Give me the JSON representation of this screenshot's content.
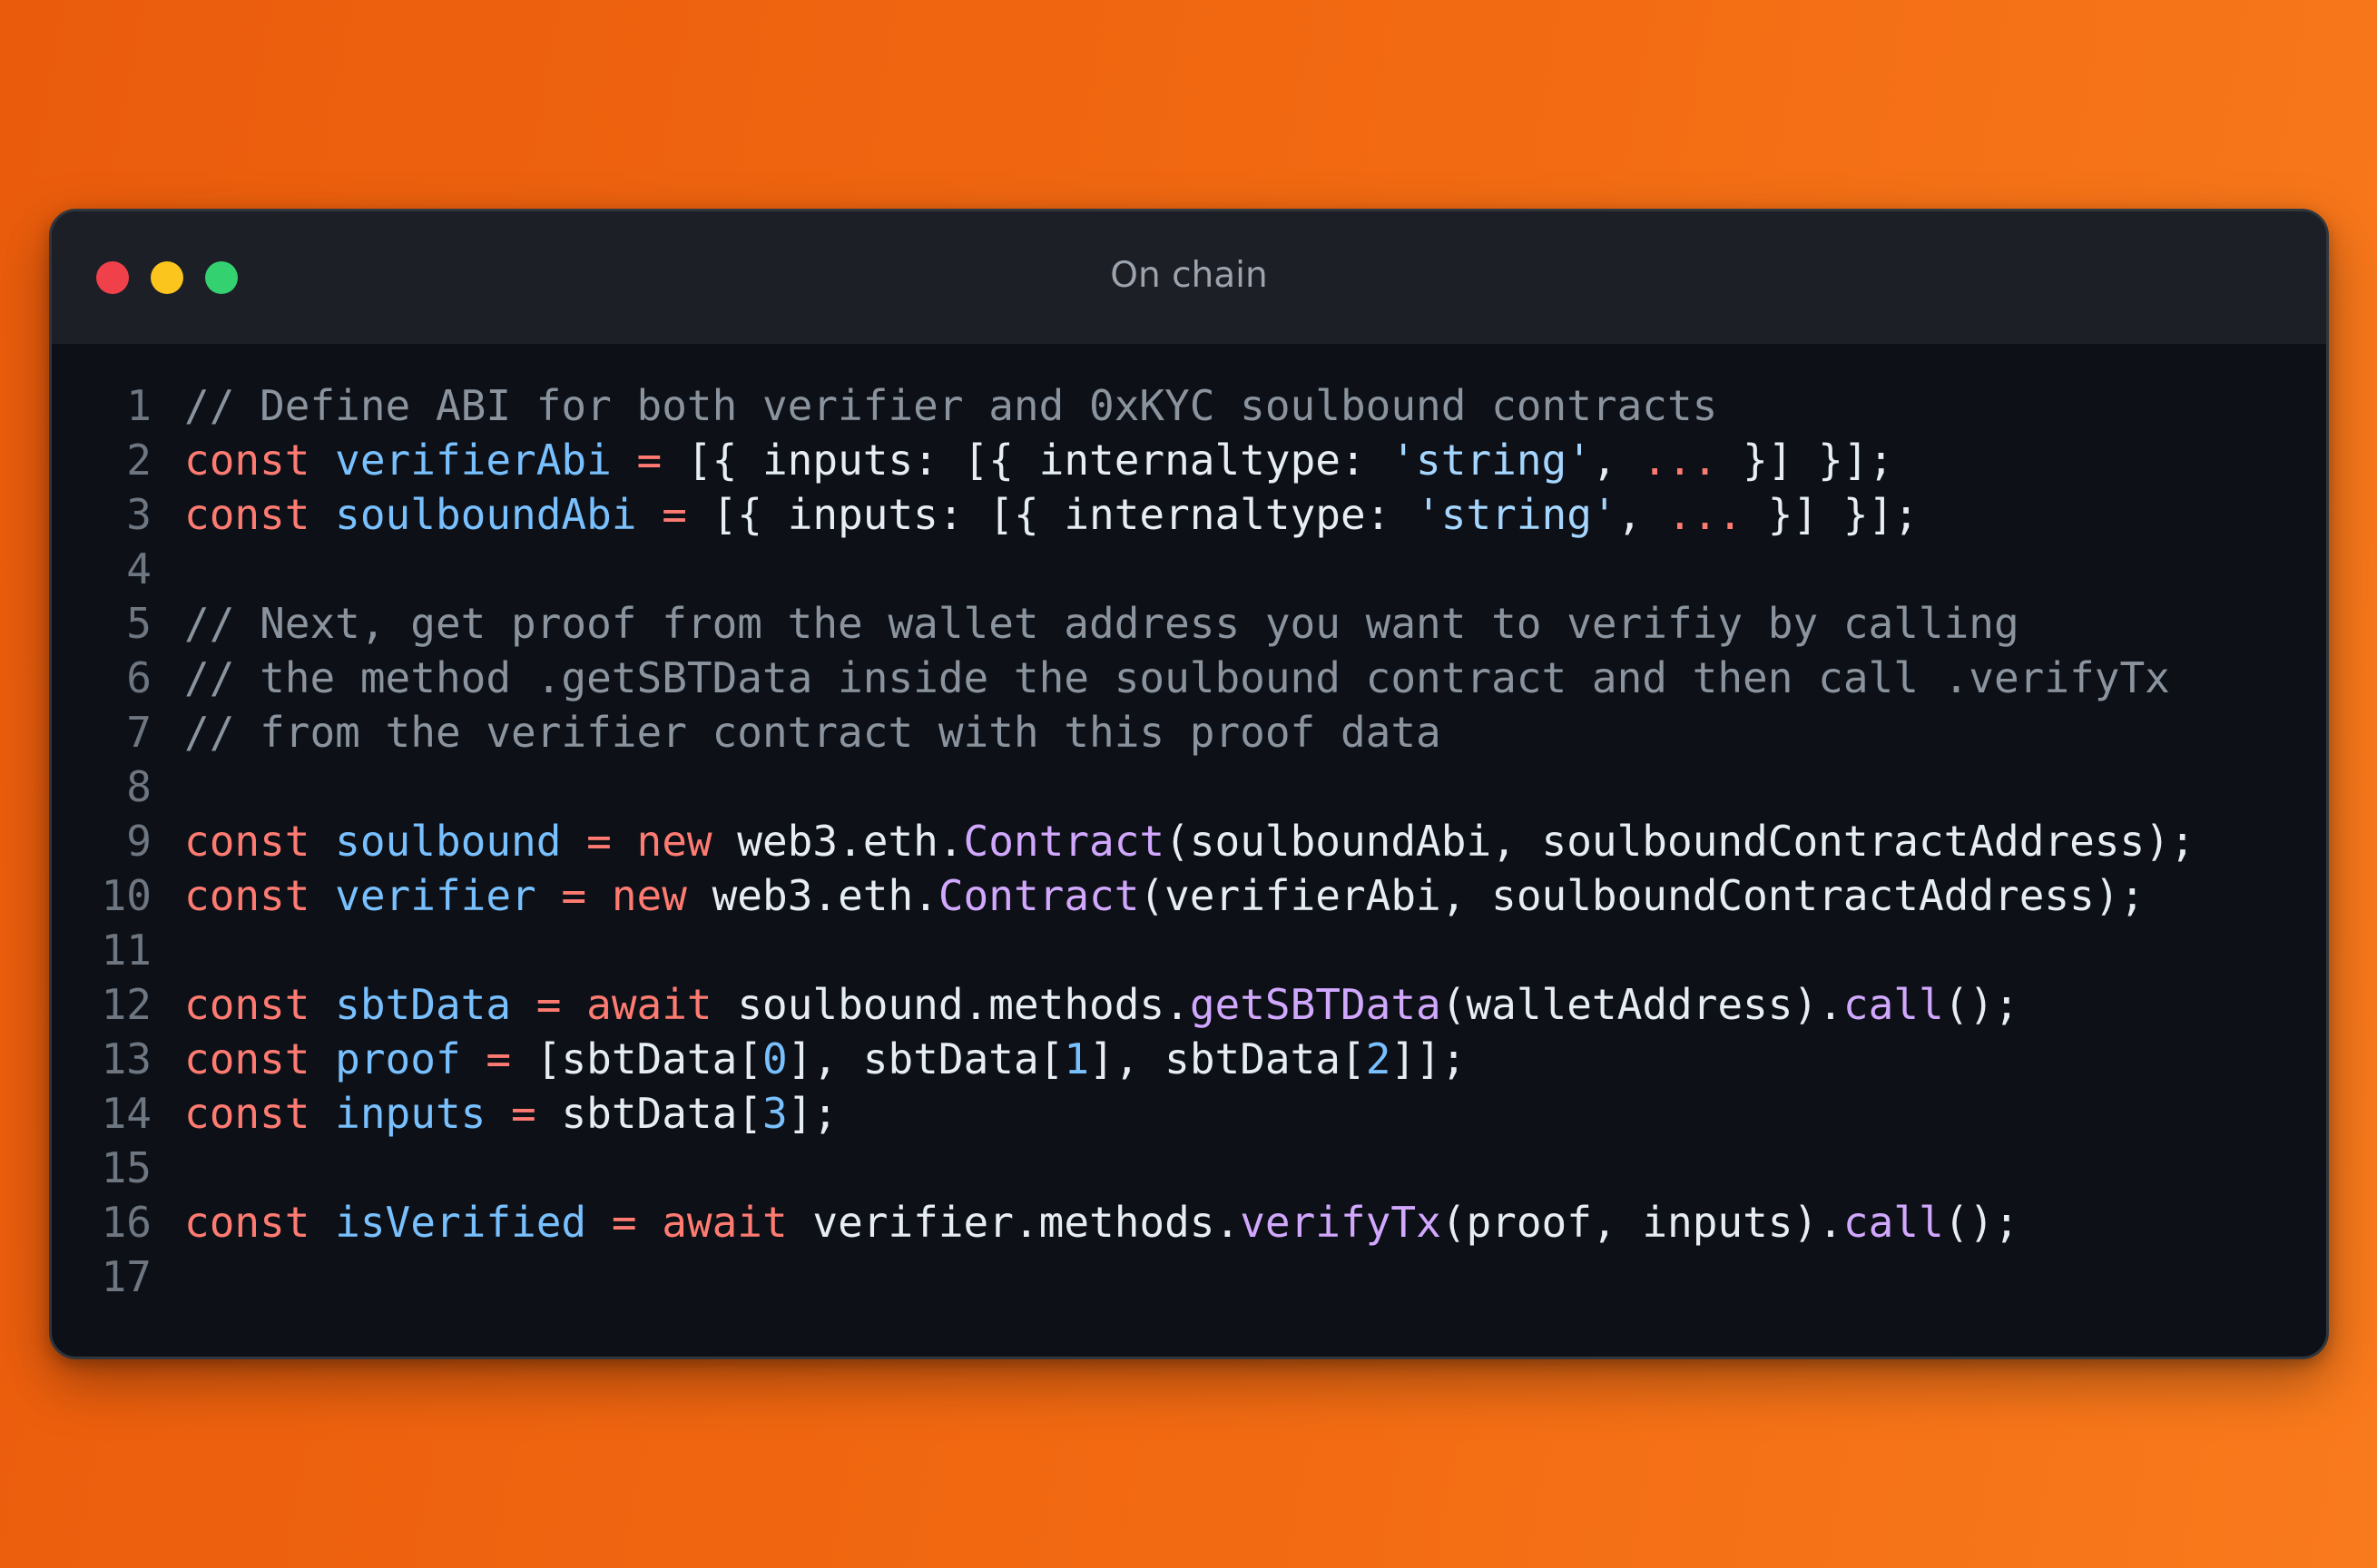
{
  "window": {
    "title": "On chain"
  },
  "colors": {
    "background": "#f26a12",
    "editor_bg": "#0d1117",
    "titlebar_bg": "#1c1f26",
    "comment": "#8b949e",
    "keyword": "#ff7b72",
    "variable": "#79c0ff",
    "string": "#a5d6ff",
    "function": "#d2a8ff",
    "number": "#79c0ff",
    "plain": "#e6edf3"
  },
  "code": {
    "lines": [
      {
        "n": "1",
        "tokens": [
          {
            "t": "// Define ABI for both verifier and 0xKYC soulbound contracts",
            "k": "comment"
          }
        ]
      },
      {
        "n": "2",
        "tokens": [
          {
            "t": "const ",
            "k": "kw"
          },
          {
            "t": "verifierAbi",
            "k": "var"
          },
          {
            "t": " = ",
            "k": "kw"
          },
          {
            "t": "[{ inputs: [{ internaltype: ",
            "k": "plain"
          },
          {
            "t": "'string'",
            "k": "str"
          },
          {
            "t": ", ",
            "k": "plain"
          },
          {
            "t": "...",
            "k": "kw"
          },
          {
            "t": " }] }];",
            "k": "plain"
          }
        ]
      },
      {
        "n": "3",
        "tokens": [
          {
            "t": "const ",
            "k": "kw"
          },
          {
            "t": "soulboundAbi",
            "k": "var"
          },
          {
            "t": " = ",
            "k": "kw"
          },
          {
            "t": "[{ inputs: [{ internaltype: ",
            "k": "plain"
          },
          {
            "t": "'string'",
            "k": "str"
          },
          {
            "t": ", ",
            "k": "plain"
          },
          {
            "t": "...",
            "k": "kw"
          },
          {
            "t": " }] }];",
            "k": "plain"
          }
        ]
      },
      {
        "n": "4",
        "tokens": []
      },
      {
        "n": "5",
        "tokens": [
          {
            "t": "// Next, get proof from the wallet address you want to verifiy by calling",
            "k": "comment"
          }
        ]
      },
      {
        "n": "6",
        "tokens": [
          {
            "t": "// the method .getSBTData inside the soulbound contract and then call .verifyTx",
            "k": "comment"
          }
        ]
      },
      {
        "n": "7",
        "tokens": [
          {
            "t": "// from the verifier contract with this proof data",
            "k": "comment"
          }
        ]
      },
      {
        "n": "8",
        "tokens": []
      },
      {
        "n": "9",
        "tokens": [
          {
            "t": "const ",
            "k": "kw"
          },
          {
            "t": "soulbound",
            "k": "var"
          },
          {
            "t": " = ",
            "k": "kw"
          },
          {
            "t": "new ",
            "k": "kw"
          },
          {
            "t": "web3.eth.",
            "k": "plain"
          },
          {
            "t": "Contract",
            "k": "fn"
          },
          {
            "t": "(soulboundAbi, soulboundContractAddress);",
            "k": "plain"
          }
        ]
      },
      {
        "n": "10",
        "tokens": [
          {
            "t": "const ",
            "k": "kw"
          },
          {
            "t": "verifier",
            "k": "var"
          },
          {
            "t": " = ",
            "k": "kw"
          },
          {
            "t": "new ",
            "k": "kw"
          },
          {
            "t": "web3.eth.",
            "k": "plain"
          },
          {
            "t": "Contract",
            "k": "fn"
          },
          {
            "t": "(verifierAbi, soulboundContractAddress);",
            "k": "plain"
          }
        ]
      },
      {
        "n": "11",
        "tokens": []
      },
      {
        "n": "12",
        "tokens": [
          {
            "t": "const ",
            "k": "kw"
          },
          {
            "t": "sbtData",
            "k": "var"
          },
          {
            "t": " = ",
            "k": "kw"
          },
          {
            "t": "await ",
            "k": "kw"
          },
          {
            "t": "soulbound.methods.",
            "k": "plain"
          },
          {
            "t": "getSBTData",
            "k": "fn"
          },
          {
            "t": "(walletAddress).",
            "k": "plain"
          },
          {
            "t": "call",
            "k": "fn"
          },
          {
            "t": "();",
            "k": "plain"
          }
        ]
      },
      {
        "n": "13",
        "tokens": [
          {
            "t": "const ",
            "k": "kw"
          },
          {
            "t": "proof",
            "k": "var"
          },
          {
            "t": " = ",
            "k": "kw"
          },
          {
            "t": "[sbtData[",
            "k": "plain"
          },
          {
            "t": "0",
            "k": "num"
          },
          {
            "t": "], sbtData[",
            "k": "plain"
          },
          {
            "t": "1",
            "k": "num"
          },
          {
            "t": "], sbtData[",
            "k": "plain"
          },
          {
            "t": "2",
            "k": "num"
          },
          {
            "t": "]];",
            "k": "plain"
          }
        ]
      },
      {
        "n": "14",
        "tokens": [
          {
            "t": "const ",
            "k": "kw"
          },
          {
            "t": "inputs",
            "k": "var"
          },
          {
            "t": " = ",
            "k": "kw"
          },
          {
            "t": "sbtData[",
            "k": "plain"
          },
          {
            "t": "3",
            "k": "num"
          },
          {
            "t": "];",
            "k": "plain"
          }
        ]
      },
      {
        "n": "15",
        "tokens": []
      },
      {
        "n": "16",
        "tokens": [
          {
            "t": "const ",
            "k": "kw"
          },
          {
            "t": "isVerified",
            "k": "var"
          },
          {
            "t": " = ",
            "k": "kw"
          },
          {
            "t": "await ",
            "k": "kw"
          },
          {
            "t": "verifier.methods.",
            "k": "plain"
          },
          {
            "t": "verifyTx",
            "k": "fn"
          },
          {
            "t": "(proof, inputs).",
            "k": "plain"
          },
          {
            "t": "call",
            "k": "fn"
          },
          {
            "t": "();",
            "k": "plain"
          }
        ]
      },
      {
        "n": "17",
        "tokens": []
      }
    ]
  }
}
